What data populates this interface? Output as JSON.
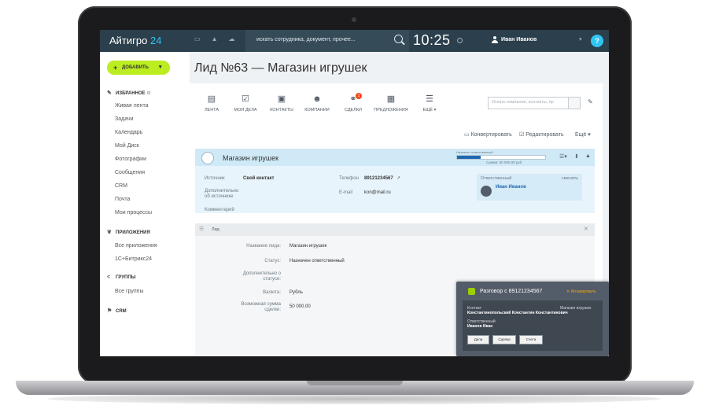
{
  "topbar": {
    "logo": "Айтигро",
    "logo_num": "24",
    "search_placeholder": "искать сотрудника, документ, прочее...",
    "clock": "10:25",
    "user_name": "Иван Иванов",
    "help": "?"
  },
  "sidebar": {
    "add_label": "ДОБАВИТЬ",
    "favorites_label": "ИЗБРАННОЕ",
    "favorites": [
      "Живая лента",
      "Задачи",
      "Календарь",
      "Мой Диск",
      "Фотографии",
      "Сообщения",
      "CRM",
      "Почта",
      "Мои процессы"
    ],
    "apps_label": "ПРИЛОЖЕНИЯ",
    "apps": [
      "Все приложения",
      "1С+Битрикс24"
    ],
    "groups_label": "ГРУППЫ",
    "groups": [
      "Все группы"
    ],
    "crm_label": "CRM"
  },
  "page": {
    "title": "Лид №63 — Магазин игрушек"
  },
  "toolbar": {
    "items": [
      "ЛЕНТА",
      "МОИ ДЕЛА",
      "КОНТАКТЫ",
      "КОМПАНИИ",
      "СДЕЛКИ",
      "ПРЕДЛОЖЕНИЯ",
      "ЕЩЁ"
    ],
    "deals_badge": "1",
    "search_placeholder": "Искать компании, контакты, пр",
    "convert": "Конвертировать",
    "edit": "Редактировать",
    "more": "Ещё"
  },
  "card": {
    "title": "Магазин игрушек",
    "resp_label": "Назначен ответственный",
    "resp_progress": 0.27,
    "sum": "Сумма: 50 000.00 руб",
    "source_k": "Источник",
    "source_v": "Свой контакт",
    "source_extra_k": "Дополнительно об источнике",
    "phone_k": "Телефон",
    "phone_v": "89121234567",
    "email_k": "E-mail",
    "email_v": "kon@mail.ru",
    "comment_k": "Комментарий",
    "responsible_label": "Ответственный",
    "change": "сменить",
    "responsible_name": "Иван Иванов"
  },
  "lead": {
    "header": "Лид",
    "fields": [
      {
        "k": "Название лида:",
        "v": "Магазин игрушек"
      },
      {
        "k": "Статус:",
        "v": "Назначен ответственный"
      },
      {
        "k": "Дополнительно о статусе:",
        "v": ""
      },
      {
        "k": "Валюта:",
        "v": "Рубль"
      },
      {
        "k": "Возможная сумма сделки:",
        "v": "50 000.00"
      }
    ]
  },
  "call": {
    "title": "Разговор с 89121234567",
    "ignore": "Игнорировать",
    "contact_k": "Контакт",
    "contact_v": "Константинопольский Константин Константинович",
    "shop": "Магазин игрушек",
    "resp_k": "Ответственный",
    "resp_v": "Иванов Иван",
    "buttons": [
      "Дела",
      "Сделки",
      "Счета"
    ]
  }
}
